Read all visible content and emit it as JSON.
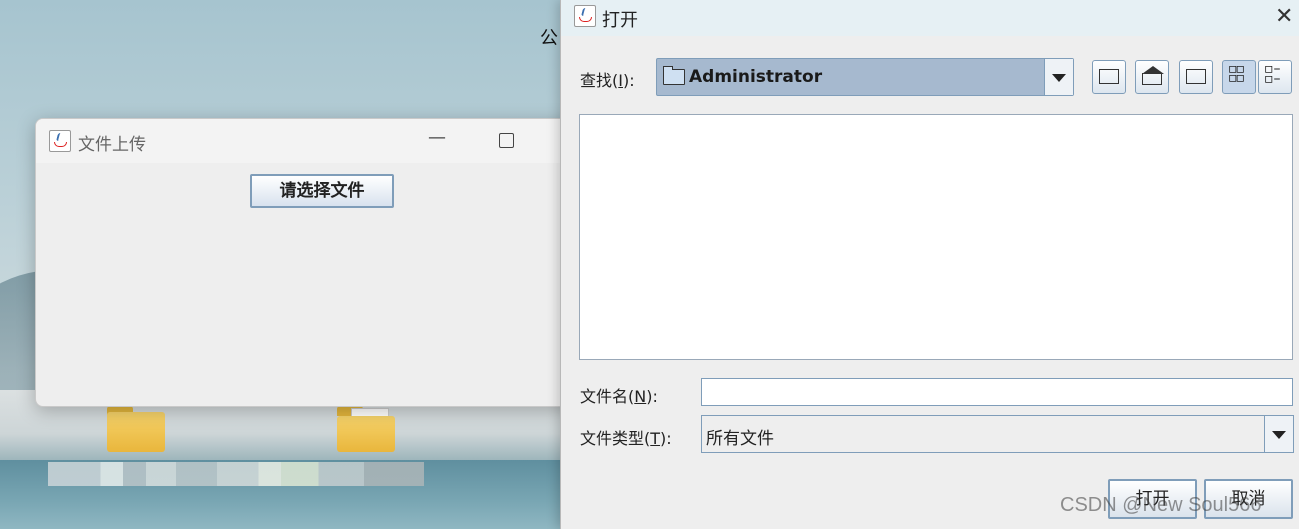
{
  "desktop": {
    "partial_label": "公"
  },
  "upload_window": {
    "title": "文件上传",
    "minimize_glyph": "—",
    "choose_button": "请选择文件"
  },
  "open_dialog": {
    "title": "打开",
    "close_glyph": "✕",
    "look_in_label": "查找",
    "look_in_mnemonic": "I",
    "look_in_value": "Administrator",
    "toolbar": [
      "up-one-level",
      "home",
      "new-folder",
      "list-view",
      "details-view"
    ],
    "file_name_label": "文件名",
    "file_name_mnemonic": "N",
    "file_name_value": "",
    "file_type_label": "文件类型",
    "file_type_mnemonic": "T",
    "file_type_value": "所有文件",
    "open_button": "打开",
    "cancel_button": "取消"
  },
  "watermark": "CSDN @New Soul566"
}
